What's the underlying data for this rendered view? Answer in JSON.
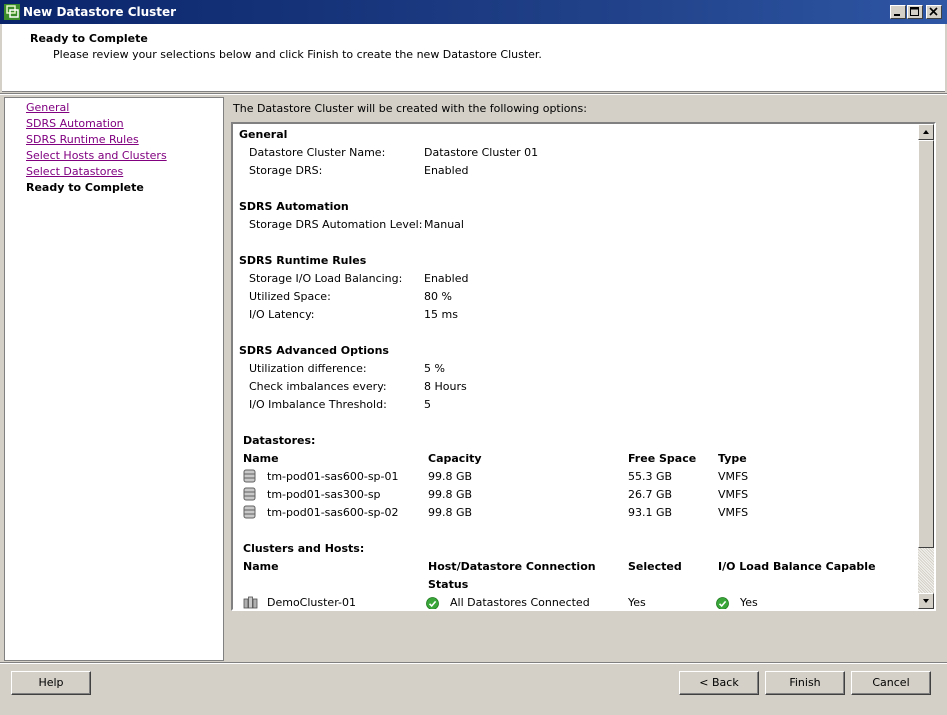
{
  "window": {
    "title": "New Datastore Cluster"
  },
  "header": {
    "title": "Ready to Complete",
    "subtitle": "Please review your selections below and click Finish to create the new Datastore Cluster."
  },
  "nav": {
    "items": [
      {
        "label": "General",
        "state": "link"
      },
      {
        "label": "SDRS Automation",
        "state": "link"
      },
      {
        "label": "SDRS Runtime Rules",
        "state": "link"
      },
      {
        "label": "Select Hosts and Clusters",
        "state": "link"
      },
      {
        "label": "Select Datastores",
        "state": "link"
      },
      {
        "label": "Ready to Complete",
        "state": "current"
      }
    ]
  },
  "main": {
    "caption": "The Datastore Cluster will be created with the following options:",
    "general": {
      "title": "General",
      "rows": [
        {
          "key": "Datastore Cluster Name:",
          "value": "Datastore Cluster 01"
        },
        {
          "key": "Storage DRS:",
          "value": "Enabled"
        }
      ]
    },
    "automation": {
      "title": "SDRS Automation",
      "rows": [
        {
          "key": "Storage DRS Automation Level:",
          "value": "Manual"
        }
      ]
    },
    "runtime": {
      "title": "SDRS Runtime Rules",
      "rows": [
        {
          "key": "Storage I/O Load Balancing:",
          "value": "Enabled"
        },
        {
          "key": "Utilized Space:",
          "value": "80 %"
        },
        {
          "key": "I/O Latency:",
          "value": "15 ms"
        }
      ]
    },
    "advanced": {
      "title": "SDRS Advanced Options",
      "rows": [
        {
          "key": "Utilization difference:",
          "value": "5 %"
        },
        {
          "key": "Check imbalances every:",
          "value": "8 Hours"
        },
        {
          "key": "I/O Imbalance Threshold:",
          "value": "5"
        }
      ]
    },
    "datastores": {
      "title": "Datastores:",
      "headers": {
        "name": "Name",
        "capacity": "Capacity",
        "free": "Free Space",
        "type": "Type"
      },
      "rows": [
        {
          "name": "tm-pod01-sas600-sp-01",
          "capacity": "99.8 GB",
          "free": "55.3 GB",
          "type": "VMFS",
          "icon": "datastore-icon"
        },
        {
          "name": "tm-pod01-sas300-sp",
          "capacity": "99.8 GB",
          "free": "26.7 GB",
          "type": "VMFS",
          "icon": "datastore-icon"
        },
        {
          "name": "tm-pod01-sas600-sp-02",
          "capacity": "99.8 GB",
          "free": "93.1 GB",
          "type": "VMFS",
          "icon": "datastore-icon"
        }
      ]
    },
    "clusters": {
      "title": "Clusters and Hosts:",
      "headers": {
        "name": "Name",
        "connection_line1": "Host/Datastore Connection",
        "connection_line2": "Status",
        "selected": "Selected",
        "balance": "I/O Load Balance Capable"
      },
      "rows": [
        {
          "name": "DemoCluster-01",
          "connection": "All Datastores Connected",
          "selected": "Yes",
          "balance": "Yes",
          "icon": "cluster-icon"
        }
      ]
    }
  },
  "buttons": {
    "help": "Help",
    "back": "< Back",
    "finish": "Finish",
    "cancel": "Cancel"
  },
  "colors": {
    "titlebar": "#0a246a",
    "visited_link": "#800080",
    "status_ok": "#3aa63a"
  }
}
